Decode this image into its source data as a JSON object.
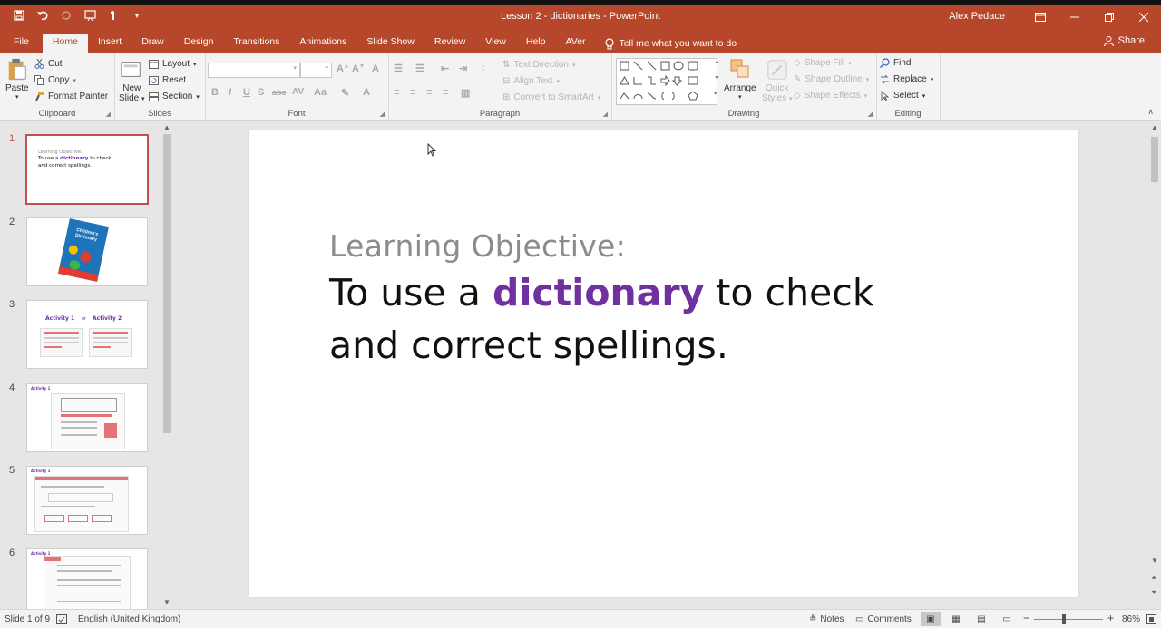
{
  "window": {
    "title": "Lesson 2 - dictionaries  -  PowerPoint",
    "user": "Alex Pedace",
    "qat_icons": [
      "save-icon",
      "undo-icon",
      "redo-icon",
      "slideshow-start-icon",
      "touch-mode-icon",
      "customize-qat-icon"
    ],
    "buttons": [
      "ribbon-display-options-icon",
      "minimize-icon",
      "restore-icon",
      "close-icon"
    ]
  },
  "tabs": {
    "items": [
      "File",
      "Home",
      "Insert",
      "Draw",
      "Design",
      "Transitions",
      "Animations",
      "Slide Show",
      "Review",
      "View",
      "Help",
      "AVer"
    ],
    "active": "Home",
    "tell_me": "Tell me what you want to do",
    "share": "Share"
  },
  "ribbon": {
    "clipboard": {
      "label": "Clipboard",
      "paste": "Paste",
      "cut": "Cut",
      "copy": "Copy",
      "format_painter": "Format Painter"
    },
    "slides": {
      "label": "Slides",
      "new_slide_line1": "New",
      "new_slide_line2": "Slide",
      "layout": "Layout",
      "reset": "Reset",
      "section": "Section"
    },
    "font": {
      "label": "Font"
    },
    "paragraph": {
      "label": "Paragraph",
      "text_direction": "Text Direction",
      "align_text": "Align Text",
      "convert_smartart": "Convert to SmartArt"
    },
    "drawing": {
      "label": "Drawing",
      "arrange": "Arrange",
      "quick_styles_line1": "Quick",
      "quick_styles_line2": "Styles",
      "shape_fill": "Shape Fill",
      "shape_outline": "Shape Outline",
      "shape_effects": "Shape Effects"
    },
    "editing": {
      "label": "Editing",
      "find": "Find",
      "replace": "Replace",
      "select": "Select"
    }
  },
  "thumbnails": {
    "numbers": [
      "1",
      "2",
      "3",
      "4",
      "5",
      "6"
    ],
    "active_index": 1,
    "slide1": {
      "small_title": "Learning Objective:",
      "line1_pre": "To use a ",
      "line1_kw": "dictionary",
      "line1_post": " to check",
      "line2": "and correct spellings."
    },
    "slide2": {
      "book_line1": "Children's",
      "book_line2": "Dictionary"
    },
    "slide3": {
      "activity1": "Activity 1",
      "or": "or",
      "activity2": "Activity 2"
    },
    "slide4": {
      "tag": "Activity 1"
    },
    "slide5": {
      "tag": "Activity 1"
    },
    "slide6": {
      "tag": "Activity 1"
    }
  },
  "slide": {
    "title": "Learning Objective:",
    "line1_pre": "To use a ",
    "line1_kw": "dictionary",
    "line1_post": " to check",
    "line2": "and correct spellings.",
    "accent_color": "#7030a0"
  },
  "status": {
    "slide_info": "Slide 1 of 9",
    "language": "English (United Kingdom)",
    "notes": "Notes",
    "comments": "Comments",
    "zoom": "86%",
    "zoom_level_percent": 86
  },
  "colors": {
    "brand": "#b7472a",
    "active_thumb": "#c0504d"
  }
}
